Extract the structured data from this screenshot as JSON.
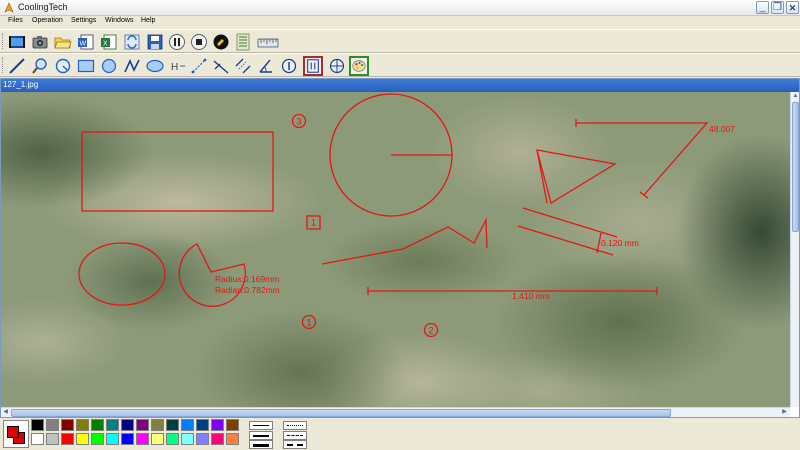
{
  "window": {
    "title": "CoolingTech",
    "minimize_symbol": "_",
    "maximize_symbol": "❐",
    "close_symbol": "✕"
  },
  "menu": [
    "Files",
    "Operation",
    "Settings",
    "Windows",
    "Help"
  ],
  "toolbar_main": [
    {
      "name": "video-capture-icon"
    },
    {
      "name": "camera-icon"
    },
    {
      "name": "open-folder-icon"
    },
    {
      "name": "word-export-icon"
    },
    {
      "name": "excel-export-icon"
    },
    {
      "name": "save-icon"
    },
    {
      "name": "pause-icon"
    },
    {
      "name": "stop-icon"
    },
    {
      "name": "adjust-icon"
    },
    {
      "name": "calibration-icon"
    },
    {
      "name": "ruler-icon"
    }
  ],
  "toolbar_draw": [
    {
      "name": "line-tool-icon"
    },
    {
      "name": "zoom-icon"
    },
    {
      "name": "circle-select-icon"
    },
    {
      "name": "rectangle-tool-icon"
    },
    {
      "name": "circle-tool-icon"
    },
    {
      "name": "polyline-tool-icon"
    },
    {
      "name": "ellipse-tool-icon"
    },
    {
      "name": "horizontal-measure-icon"
    },
    {
      "name": "distance-tool-icon"
    },
    {
      "name": "perpendicular-tool-icon"
    },
    {
      "name": "parallel-tool-icon"
    },
    {
      "name": "angle-tool-icon"
    },
    {
      "name": "numbering-tool-icon"
    },
    {
      "name": "text-box-tool-icon",
      "state": "selected"
    },
    {
      "name": "crosshair-tool-icon"
    },
    {
      "name": "color-palette-icon",
      "state": "selected"
    }
  ],
  "document": {
    "title": "127_1.jpg",
    "annotations": {
      "markers": [
        "3",
        "1",
        "2"
      ],
      "box_label": "1",
      "radius_text": "Radius:0.169mm",
      "radian_text": "Radian:0.782mm",
      "distance_text": "1.410 mm",
      "parallel_text": "0.120 mm",
      "angle_text": "48.007"
    },
    "annotation_color": "#e01818"
  },
  "palette": {
    "current_color": "#e00000",
    "row1": [
      "#000000",
      "#808080",
      "#800000",
      "#808000",
      "#008000",
      "#008080",
      "#000080",
      "#800080",
      "#808040",
      "#004040",
      "#0080ff",
      "#004080",
      "#8000ff",
      "#804000"
    ],
    "row2": [
      "#ffffff",
      "#c0c0c0",
      "#ff0000",
      "#ffff00",
      "#00ff00",
      "#00ffff",
      "#0000ff",
      "#ff00ff",
      "#ffff80",
      "#00ff80",
      "#80ffff",
      "#8080ff",
      "#ff0080",
      "#ff8040"
    ]
  }
}
